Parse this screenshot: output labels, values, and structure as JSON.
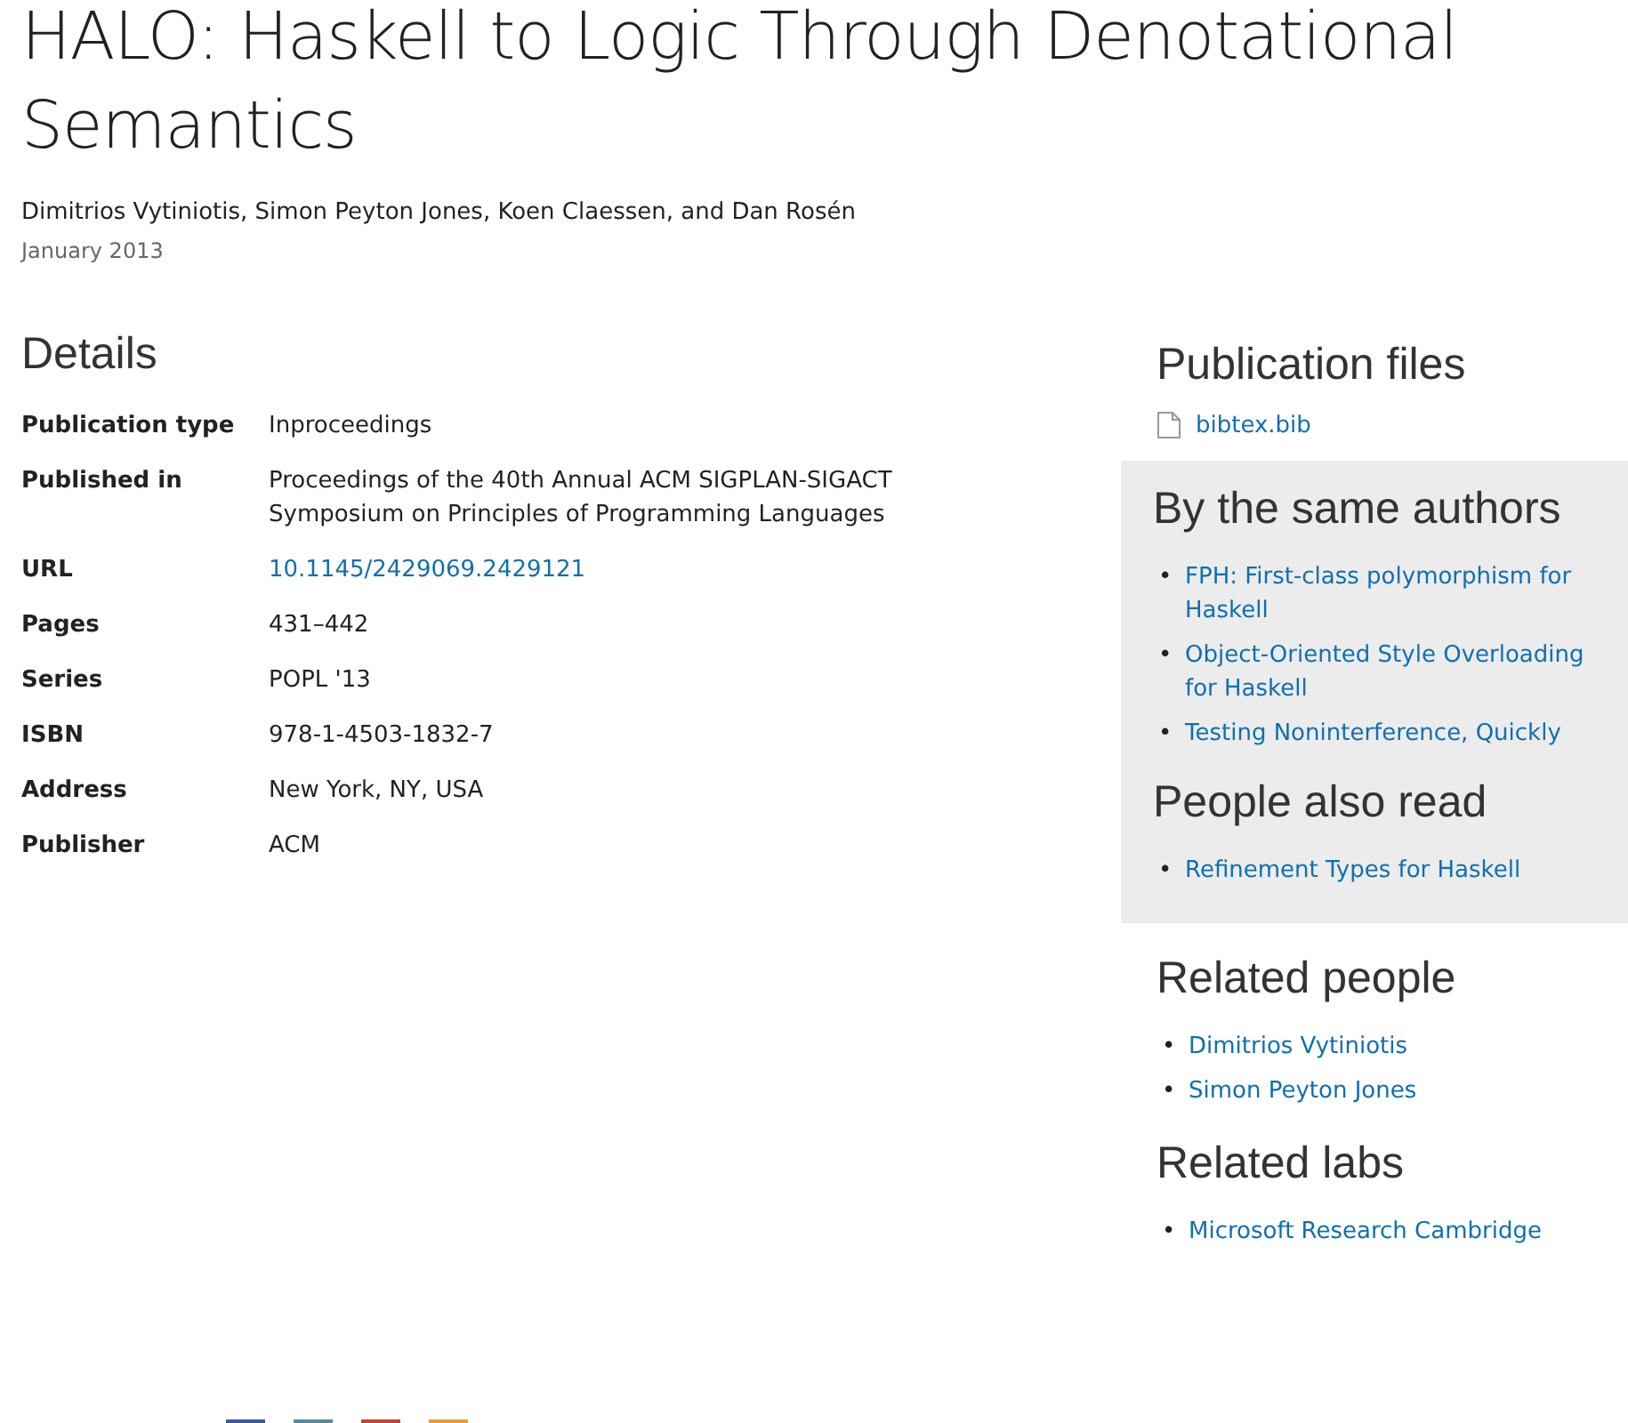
{
  "title": "HALO: Haskell to Logic Through Denotational Semantics",
  "authors": "Dimitrios Vytiniotis, Simon Peyton Jones, Koen Claessen, and Dan Rosén",
  "date": "January 2013",
  "details": {
    "heading": "Details",
    "rows": [
      {
        "label": "Publication type",
        "value": "Inproceedings",
        "kind": "text"
      },
      {
        "label": "Published in",
        "value": "Proceedings of the 40th Annual ACM SIGPLAN-SIGACT Symposium on Principles of Programming Languages",
        "kind": "text"
      },
      {
        "label": "URL",
        "value": "10.1145/2429069.2429121",
        "kind": "link"
      },
      {
        "label": "Pages",
        "value": "431–442",
        "kind": "text"
      },
      {
        "label": "Series",
        "value": "POPL '13",
        "kind": "text"
      },
      {
        "label": "ISBN",
        "value": "978-1-4503-1832-7",
        "kind": "text"
      },
      {
        "label": "Address",
        "value": "New York, NY, USA",
        "kind": "text"
      },
      {
        "label": "Publisher",
        "value": "ACM",
        "kind": "text"
      }
    ]
  },
  "bullet": "•",
  "publication_files": {
    "heading": "Publication files",
    "files": [
      "bibtex.bib"
    ]
  },
  "same_authors": {
    "heading": "By the same authors",
    "links": [
      "FPH: First-class polymorphism for Haskell",
      "Object-Oriented Style Overloading for Haskell",
      "Testing Noninterference, Quickly"
    ]
  },
  "also_read": {
    "heading": "People also read",
    "links": [
      "Refinement Types for Haskell"
    ]
  },
  "related_people": {
    "heading": "Related people",
    "links": [
      "Dimitrios Vytiniotis",
      "Simon Peyton Jones"
    ]
  },
  "related_labs": {
    "heading": "Related labs",
    "links": [
      "Microsoft Research Cambridge"
    ]
  }
}
